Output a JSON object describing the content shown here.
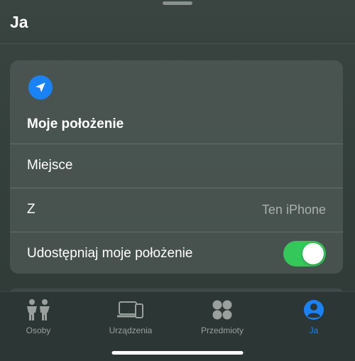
{
  "header": {
    "title": "Ja"
  },
  "card": {
    "title": "Moje położenie",
    "rows": [
      {
        "label": "Miejsce",
        "value": ""
      },
      {
        "label": "Z",
        "value": "Ten iPhone"
      },
      {
        "label": "Udostępniaj moje położenie",
        "toggle": true
      }
    ]
  },
  "tabs": [
    {
      "label": "Osoby",
      "icon": "people-icon",
      "active": false
    },
    {
      "label": "Urządzenia",
      "icon": "devices-icon",
      "active": false
    },
    {
      "label": "Przedmioty",
      "icon": "items-icon",
      "active": false
    },
    {
      "label": "Ja",
      "icon": "person-circle-icon",
      "active": true
    }
  ],
  "colors": {
    "accent": "#1a82f7",
    "toggle_on": "#34c759",
    "inactive_tab": "#9aa09e"
  }
}
